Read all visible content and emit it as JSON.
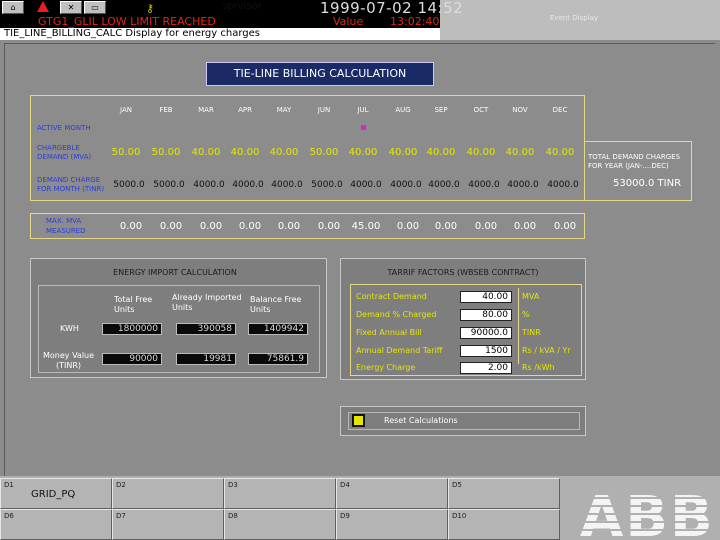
{
  "topbar": {
    "supervisor": "sprvisor",
    "datetime": "1999-07-02  14:52",
    "alarm_text": "GTG1_GLIL  LOW LIMIT REACHED",
    "alarm_type": "Value",
    "alarm_time": "13:02:40",
    "event_display": "Event Display",
    "display_title": "TIE_LINE_BILLING_CALC  Display for energy charges",
    "toolbar_icons": [
      "home-icon",
      "warning-icon",
      "acknowledge-icon",
      "minimize-icon",
      "key-icon"
    ]
  },
  "billing": {
    "title": "TIE-LINE BILLING CALCULATION",
    "months": [
      "JAN",
      "FEB",
      "MAR",
      "APR",
      "MAY",
      "JUN",
      "JUL",
      "AUG",
      "SEP",
      "OCT",
      "NOV",
      "DEC"
    ],
    "row_labels": {
      "active_month": "ACTIVE MONTH",
      "chargeable_1": "CHARGEBLE",
      "chargeable_2": "DEMAND (MVA)",
      "demand_charge_1": "DEMAND CHARGE",
      "demand_charge_2": "FOR MONTH (TINR)",
      "max_mva_1": "MAX.  MVA",
      "max_mva_2": "MEASURED"
    },
    "active_month_index": 6,
    "chargeable_demand": [
      "50.00",
      "50.00",
      "40.00",
      "40.00",
      "40.00",
      "50.00",
      "40.00",
      "40.00",
      "40.00",
      "40.00",
      "40.00",
      "40.00"
    ],
    "demand_charge": [
      "5000.0",
      "5000.0",
      "4000.0",
      "4000.0",
      "4000.0",
      "5000.0",
      "4000.0",
      "4000.0",
      "4000.0",
      "4000.0",
      "4000.0",
      "4000.0"
    ],
    "max_mva": [
      "0.00",
      "0.00",
      "0.00",
      "0.00",
      "0.00",
      "0.00",
      "45.00",
      "0.00",
      "0.00",
      "0.00",
      "0.00",
      "0.00"
    ],
    "total_label_1": "TOTAL DEMAND CHARGES",
    "total_label_2": "FOR YEAR (JAN-....DEC)",
    "total_value": "53000.0  TINR"
  },
  "energy": {
    "title": "ENERGY IMPORT CALCULATION",
    "col_total": [
      "Total  Free",
      "Units"
    ],
    "col_imported": [
      "Already Imported",
      "Units"
    ],
    "col_balance": [
      "Balance Free",
      "Units"
    ],
    "row_kwh": "KWH",
    "row_money": [
      "Money Value",
      "(TINR)"
    ],
    "kwh_values": [
      "1800000",
      "390058",
      "1409942"
    ],
    "money_values": [
      "90000",
      "19981",
      "75861.9"
    ]
  },
  "tariff": {
    "title": "TARRIF FACTORS  (WBSEB CONTRACT)",
    "rows": [
      {
        "label": "Contract Demand",
        "value": "40.00",
        "unit": "MVA"
      },
      {
        "label": "Demand % Charged",
        "value": "80.00",
        "unit": "%"
      },
      {
        "label": "Fixed Annual Bill",
        "value": "90000.0",
        "unit": "TINR"
      },
      {
        "label": "Annual Demand Tariff",
        "value": "1500",
        "unit": "Rs / kVA / Yr"
      },
      {
        "label": "Energy Charge",
        "value": "2.00",
        "unit": "Rs /kWh"
      }
    ]
  },
  "reset": {
    "label": "Reset Calculations"
  },
  "nav": {
    "keys": [
      {
        "code": "D1",
        "label": "GRID_PQ"
      },
      {
        "code": "D2",
        "label": ""
      },
      {
        "code": "D3",
        "label": ""
      },
      {
        "code": "D4",
        "label": ""
      },
      {
        "code": "D5",
        "label": ""
      },
      {
        "code": "D6",
        "label": ""
      },
      {
        "code": "D7",
        "label": ""
      },
      {
        "code": "D8",
        "label": ""
      },
      {
        "code": "D9",
        "label": ""
      },
      {
        "code": "D10",
        "label": ""
      }
    ],
    "logo_text": "ABB"
  },
  "colors": {
    "value_yellow": "#e6e600",
    "label_blue": "#2a3ce0",
    "alarm_red": "#e0261b",
    "active_marker": "#e020e0",
    "title_bg": "#1a2a66"
  }
}
